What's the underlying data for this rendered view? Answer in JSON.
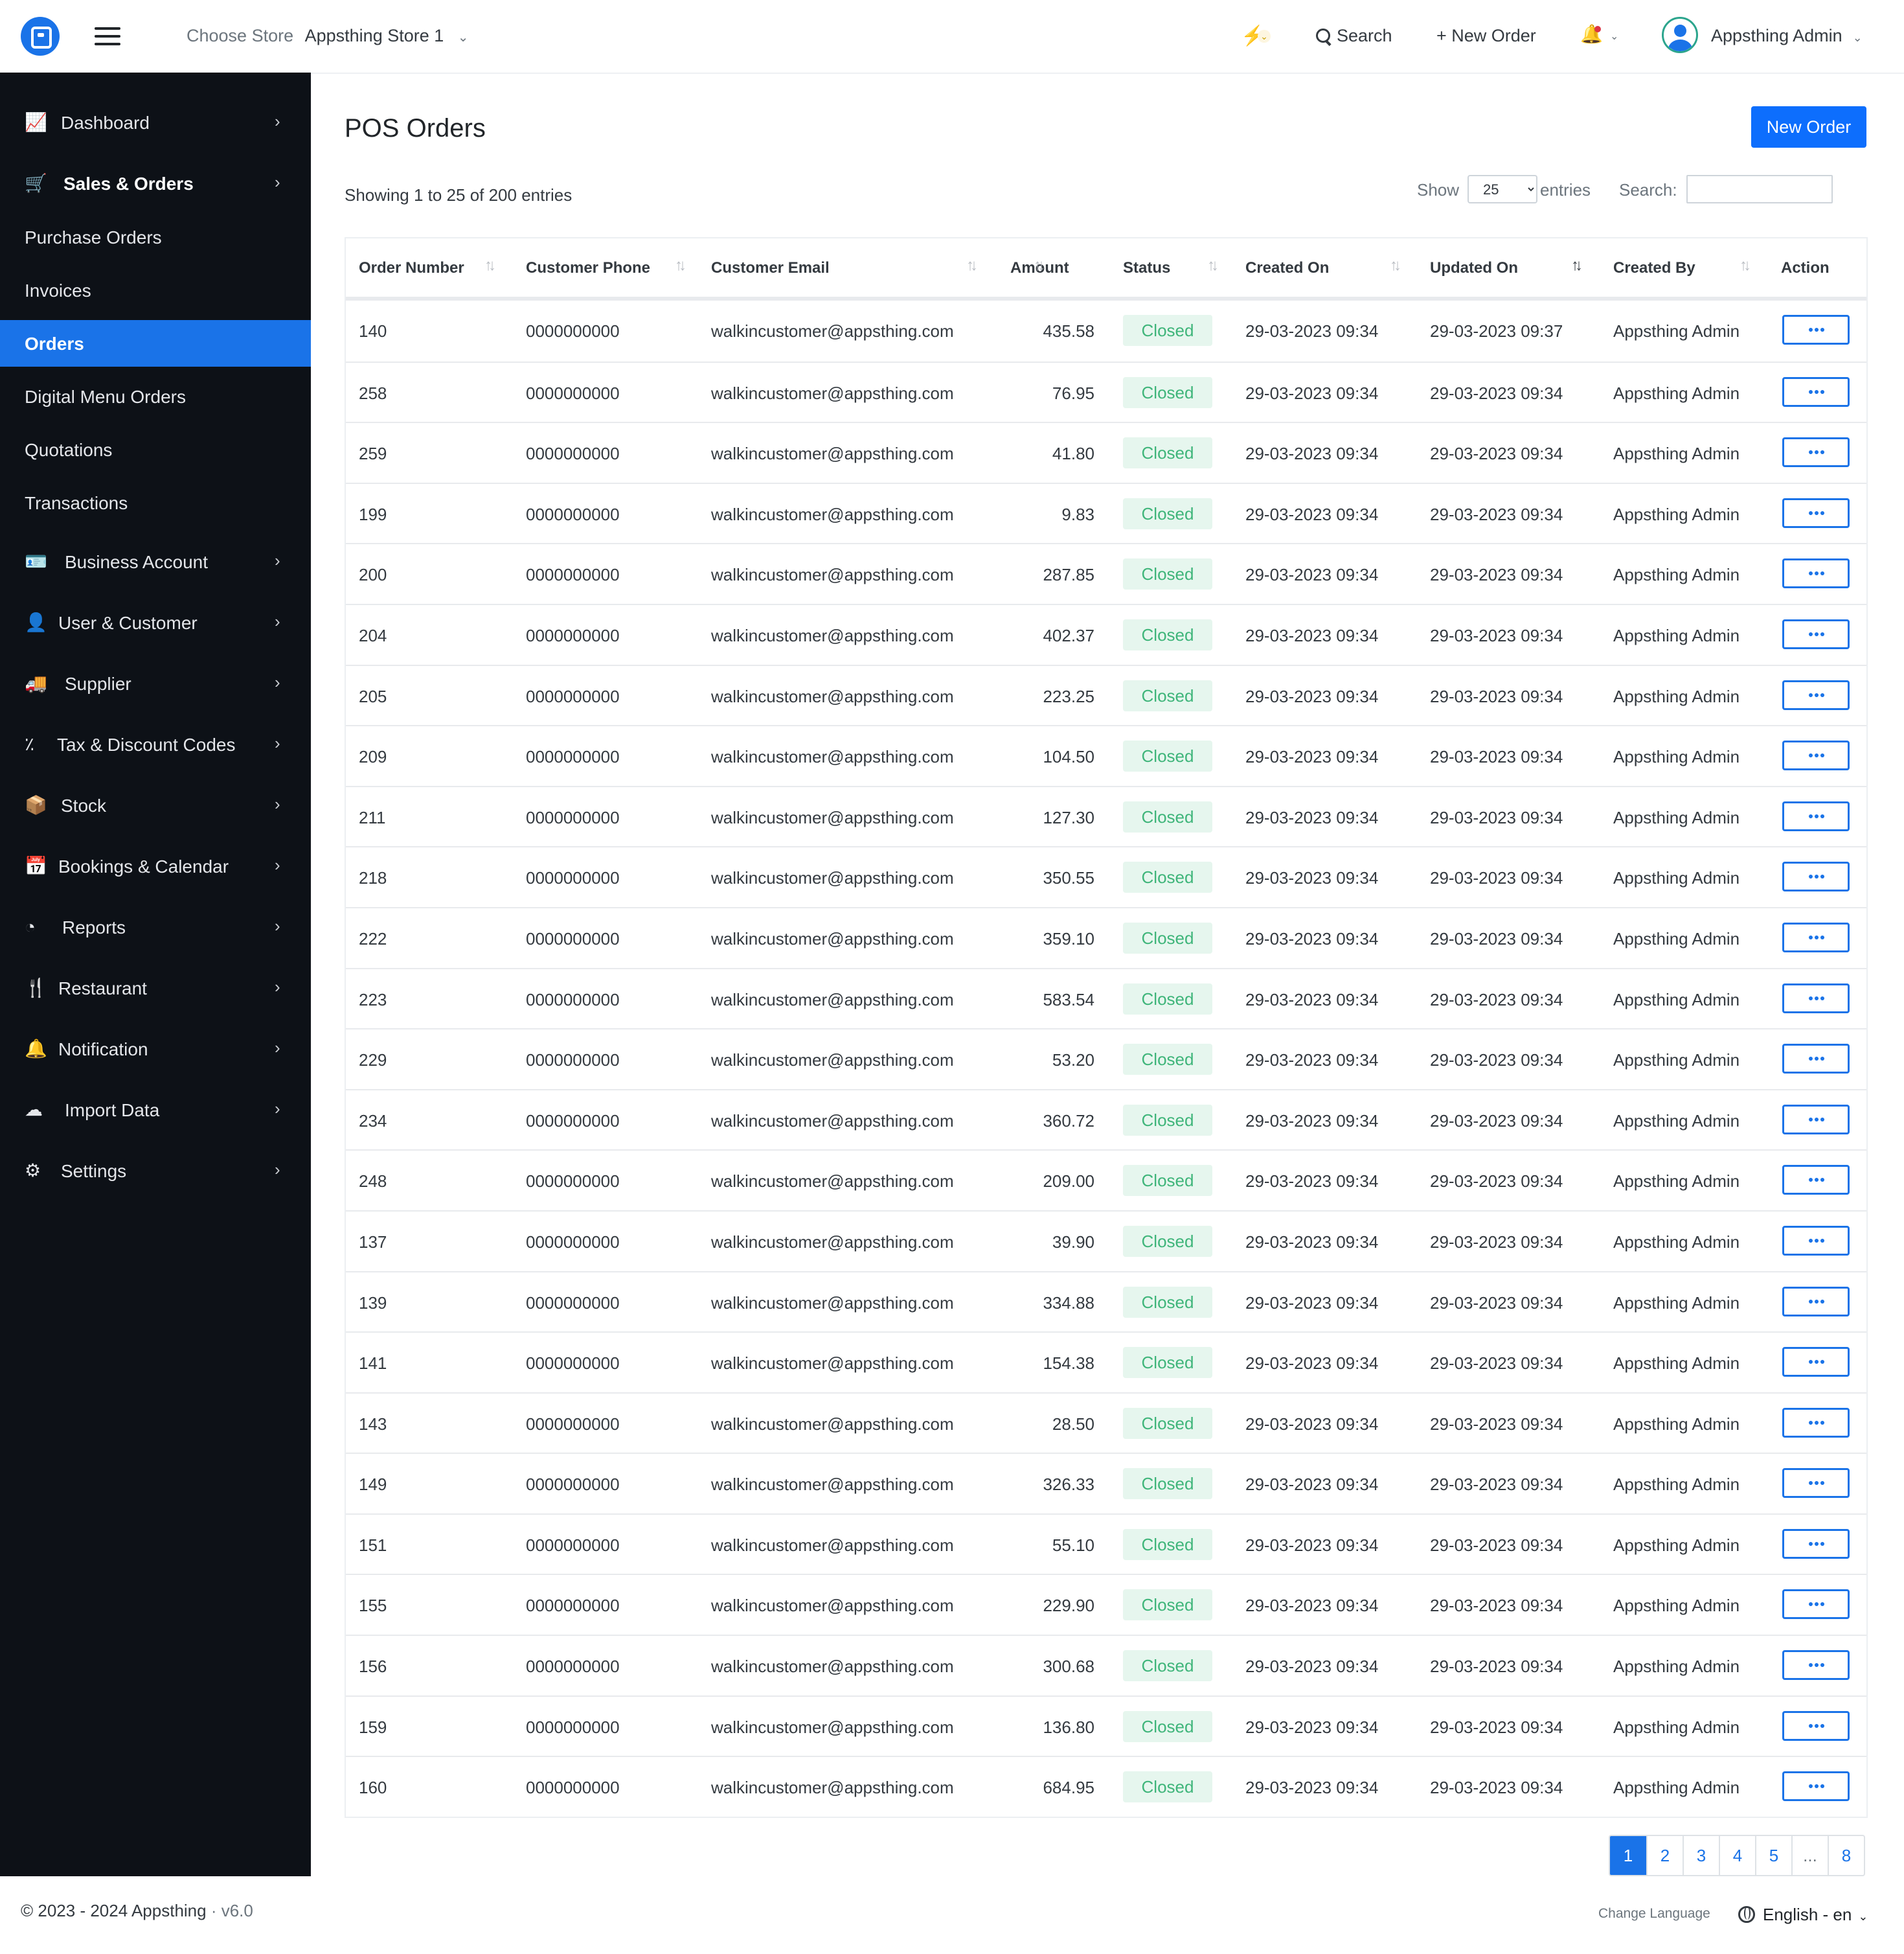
{
  "header": {
    "choose_store_label": "Choose Store",
    "store_name": "Appsthing Store 1",
    "search_label": "Search",
    "new_order_label": "+ New Order",
    "user_name": "Appsthing Admin"
  },
  "sidebar": {
    "items": [
      {
        "label": "Dashboard",
        "icon": "chart-line-icon"
      },
      {
        "label": "Sales & Orders",
        "icon": "cart-icon"
      },
      {
        "label": "Purchase Orders"
      },
      {
        "label": "Invoices"
      },
      {
        "label": "Orders"
      },
      {
        "label": "Digital Menu Orders"
      },
      {
        "label": "Quotations"
      },
      {
        "label": "Transactions"
      },
      {
        "label": "Business Account",
        "icon": "id-card-icon"
      },
      {
        "label": "User & Customer",
        "icon": "user-icon"
      },
      {
        "label": "Supplier",
        "icon": "truck-icon"
      },
      {
        "label": "Tax & Discount Codes",
        "icon": "percent-icon"
      },
      {
        "label": "Stock",
        "icon": "boxes-icon"
      },
      {
        "label": "Bookings & Calendar",
        "icon": "calendar-icon"
      },
      {
        "label": "Reports",
        "icon": "pie-chart-icon"
      },
      {
        "label": "Restaurant",
        "icon": "utensils-icon"
      },
      {
        "label": "Notification",
        "icon": "bell-icon"
      },
      {
        "label": "Import Data",
        "icon": "cloud-upload-icon"
      },
      {
        "label": "Settings",
        "icon": "gear-icon"
      }
    ]
  },
  "main": {
    "title": "POS Orders",
    "new_order_button": "New Order",
    "showing": "Showing 1 to 25 of 200 entries",
    "show_label": "Show",
    "page_length": "25",
    "entries_label": "entries",
    "search_label": "Search:"
  },
  "table": {
    "columns": [
      "Order Number",
      "Customer Phone",
      "Customer Email",
      "Amount",
      "Status",
      "Created On",
      "Updated On",
      "Created By",
      "Action"
    ],
    "rows": [
      [
        "140",
        "0000000000",
        "walkincustomer@appsthing.com",
        "435.58",
        "Closed",
        "29-03-2023 09:34",
        "29-03-2023 09:37",
        "Appsthing Admin"
      ],
      [
        "258",
        "0000000000",
        "walkincustomer@appsthing.com",
        "76.95",
        "Closed",
        "29-03-2023 09:34",
        "29-03-2023 09:34",
        "Appsthing Admin"
      ],
      [
        "259",
        "0000000000",
        "walkincustomer@appsthing.com",
        "41.80",
        "Closed",
        "29-03-2023 09:34",
        "29-03-2023 09:34",
        "Appsthing Admin"
      ],
      [
        "199",
        "0000000000",
        "walkincustomer@appsthing.com",
        "9.83",
        "Closed",
        "29-03-2023 09:34",
        "29-03-2023 09:34",
        "Appsthing Admin"
      ],
      [
        "200",
        "0000000000",
        "walkincustomer@appsthing.com",
        "287.85",
        "Closed",
        "29-03-2023 09:34",
        "29-03-2023 09:34",
        "Appsthing Admin"
      ],
      [
        "204",
        "0000000000",
        "walkincustomer@appsthing.com",
        "402.37",
        "Closed",
        "29-03-2023 09:34",
        "29-03-2023 09:34",
        "Appsthing Admin"
      ],
      [
        "205",
        "0000000000",
        "walkincustomer@appsthing.com",
        "223.25",
        "Closed",
        "29-03-2023 09:34",
        "29-03-2023 09:34",
        "Appsthing Admin"
      ],
      [
        "209",
        "0000000000",
        "walkincustomer@appsthing.com",
        "104.50",
        "Closed",
        "29-03-2023 09:34",
        "29-03-2023 09:34",
        "Appsthing Admin"
      ],
      [
        "211",
        "0000000000",
        "walkincustomer@appsthing.com",
        "127.30",
        "Closed",
        "29-03-2023 09:34",
        "29-03-2023 09:34",
        "Appsthing Admin"
      ],
      [
        "218",
        "0000000000",
        "walkincustomer@appsthing.com",
        "350.55",
        "Closed",
        "29-03-2023 09:34",
        "29-03-2023 09:34",
        "Appsthing Admin"
      ],
      [
        "222",
        "0000000000",
        "walkincustomer@appsthing.com",
        "359.10",
        "Closed",
        "29-03-2023 09:34",
        "29-03-2023 09:34",
        "Appsthing Admin"
      ],
      [
        "223",
        "0000000000",
        "walkincustomer@appsthing.com",
        "583.54",
        "Closed",
        "29-03-2023 09:34",
        "29-03-2023 09:34",
        "Appsthing Admin"
      ],
      [
        "229",
        "0000000000",
        "walkincustomer@appsthing.com",
        "53.20",
        "Closed",
        "29-03-2023 09:34",
        "29-03-2023 09:34",
        "Appsthing Admin"
      ],
      [
        "234",
        "0000000000",
        "walkincustomer@appsthing.com",
        "360.72",
        "Closed",
        "29-03-2023 09:34",
        "29-03-2023 09:34",
        "Appsthing Admin"
      ],
      [
        "248",
        "0000000000",
        "walkincustomer@appsthing.com",
        "209.00",
        "Closed",
        "29-03-2023 09:34",
        "29-03-2023 09:34",
        "Appsthing Admin"
      ],
      [
        "137",
        "0000000000",
        "walkincustomer@appsthing.com",
        "39.90",
        "Closed",
        "29-03-2023 09:34",
        "29-03-2023 09:34",
        "Appsthing Admin"
      ],
      [
        "139",
        "0000000000",
        "walkincustomer@appsthing.com",
        "334.88",
        "Closed",
        "29-03-2023 09:34",
        "29-03-2023 09:34",
        "Appsthing Admin"
      ],
      [
        "141",
        "0000000000",
        "walkincustomer@appsthing.com",
        "154.38",
        "Closed",
        "29-03-2023 09:34",
        "29-03-2023 09:34",
        "Appsthing Admin"
      ],
      [
        "143",
        "0000000000",
        "walkincustomer@appsthing.com",
        "28.50",
        "Closed",
        "29-03-2023 09:34",
        "29-03-2023 09:34",
        "Appsthing Admin"
      ],
      [
        "149",
        "0000000000",
        "walkincustomer@appsthing.com",
        "326.33",
        "Closed",
        "29-03-2023 09:34",
        "29-03-2023 09:34",
        "Appsthing Admin"
      ],
      [
        "151",
        "0000000000",
        "walkincustomer@appsthing.com",
        "55.10",
        "Closed",
        "29-03-2023 09:34",
        "29-03-2023 09:34",
        "Appsthing Admin"
      ],
      [
        "155",
        "0000000000",
        "walkincustomer@appsthing.com",
        "229.90",
        "Closed",
        "29-03-2023 09:34",
        "29-03-2023 09:34",
        "Appsthing Admin"
      ],
      [
        "156",
        "0000000000",
        "walkincustomer@appsthing.com",
        "300.68",
        "Closed",
        "29-03-2023 09:34",
        "29-03-2023 09:34",
        "Appsthing Admin"
      ],
      [
        "159",
        "0000000000",
        "walkincustomer@appsthing.com",
        "136.80",
        "Closed",
        "29-03-2023 09:34",
        "29-03-2023 09:34",
        "Appsthing Admin"
      ],
      [
        "160",
        "0000000000",
        "walkincustomer@appsthing.com",
        "684.95",
        "Closed",
        "29-03-2023 09:34",
        "29-03-2023 09:34",
        "Appsthing Admin"
      ]
    ]
  },
  "pagination": {
    "pages": [
      "1",
      "2",
      "3",
      "4",
      "5",
      "...",
      "8"
    ],
    "current": "1"
  },
  "footer": {
    "copyright": "© 2023 - 2024 Appsthing",
    "version": "· v6.0",
    "change_language": "Change Language",
    "language": "English - en"
  },
  "colors": {
    "primary": "#1a73e8",
    "sidebar_bg": "#0d1117",
    "status_closed_bg": "#e6f6ee",
    "status_closed_text": "#3fb57a"
  }
}
